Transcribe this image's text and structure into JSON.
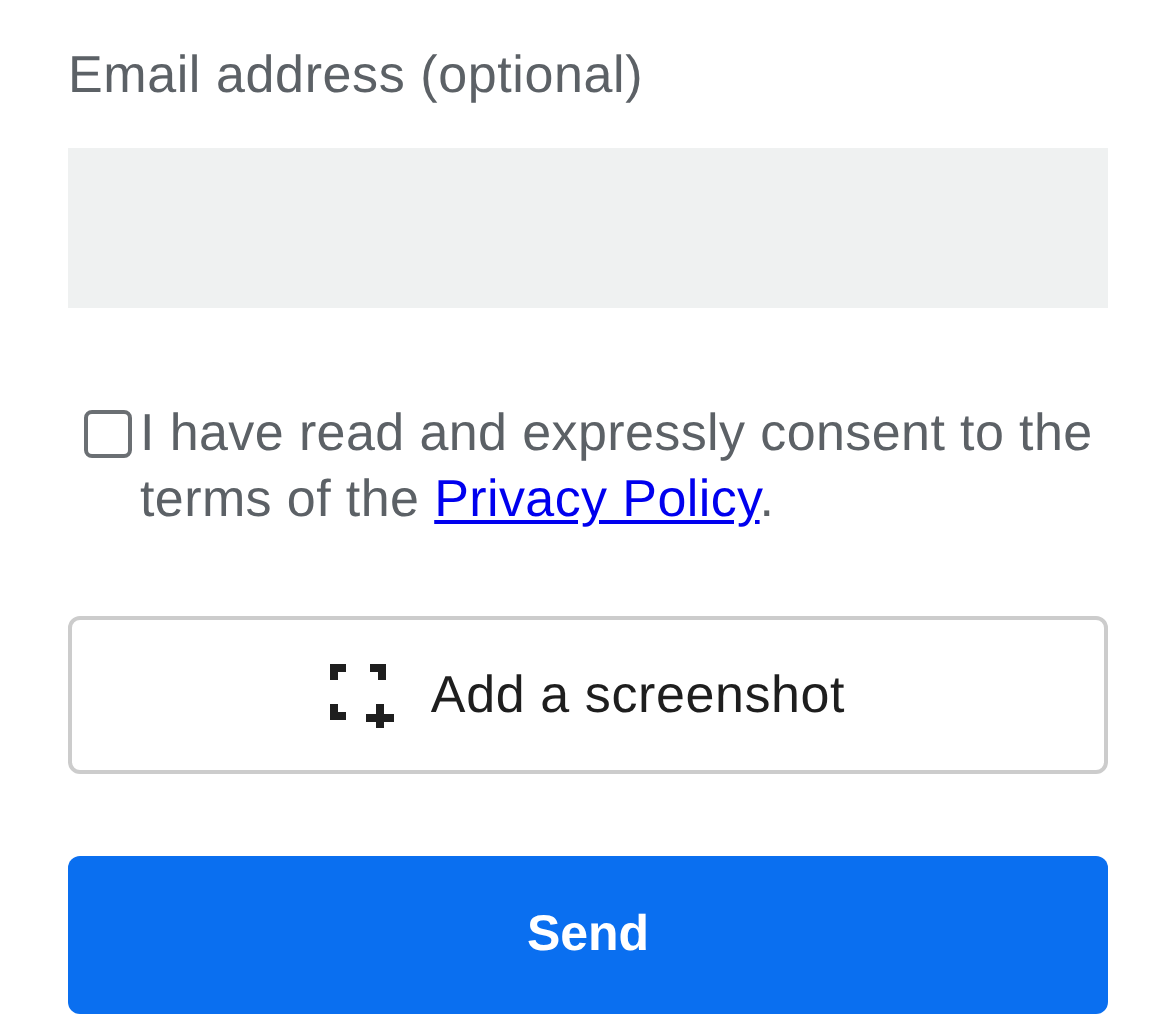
{
  "email": {
    "label": "Email address (optional)"
  },
  "consent": {
    "checked": false,
    "text_before": "I have read and expressly consent to the terms of the ",
    "link": "Privacy Policy",
    "text_after": "."
  },
  "screenshot_button": {
    "label": "Add a screenshot"
  },
  "send_button": {
    "label": "Send"
  }
}
